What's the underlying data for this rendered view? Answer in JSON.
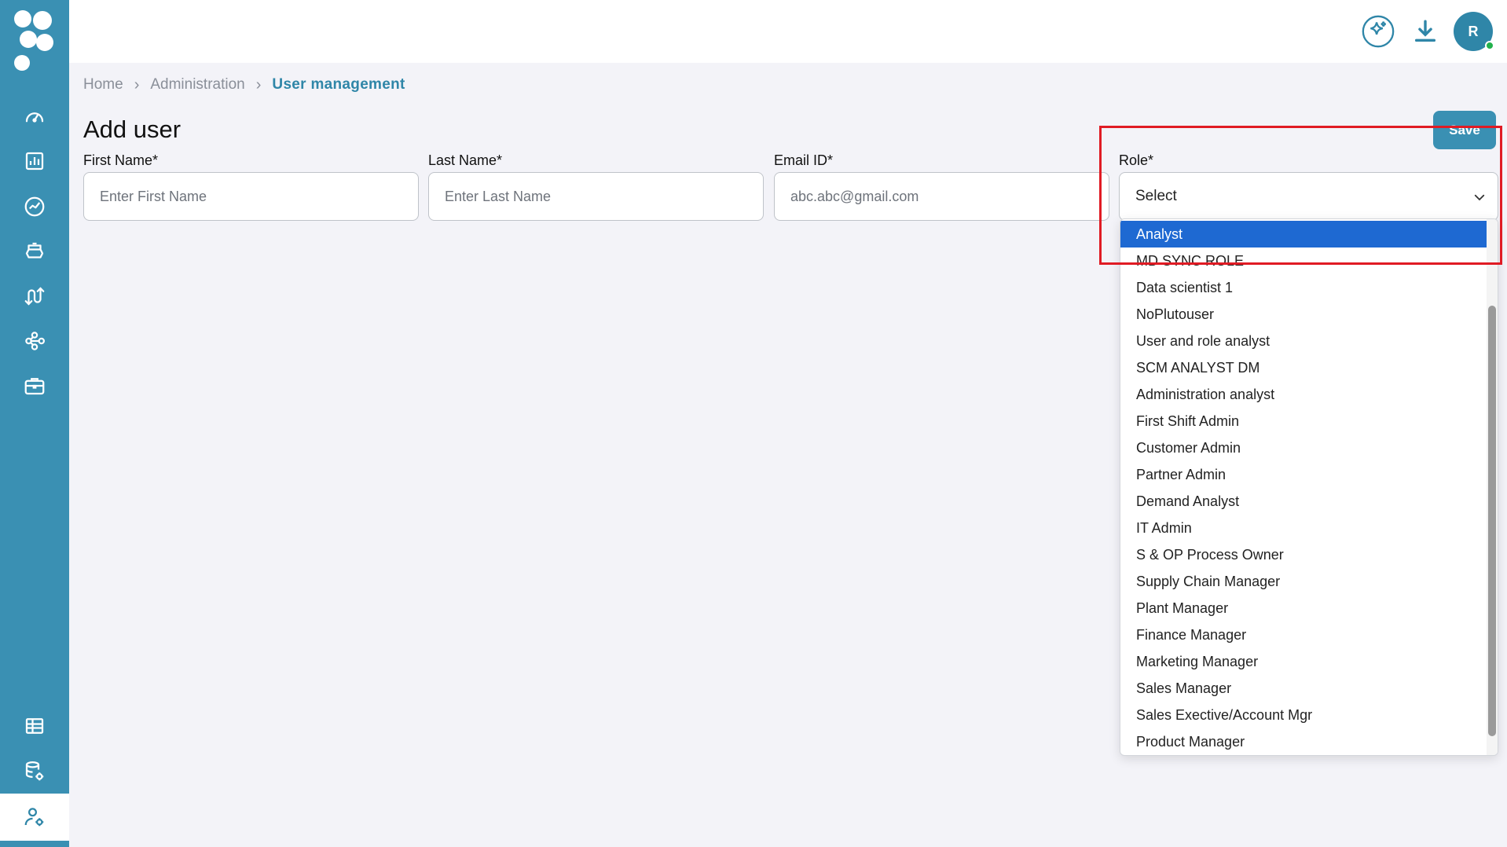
{
  "breadcrumb": {
    "home": "Home",
    "admin": "Administration",
    "current": "User management"
  },
  "page": {
    "title": "Add user",
    "save_label": "Save"
  },
  "form": {
    "first_name": {
      "label": "First Name*",
      "placeholder": "Enter First Name"
    },
    "last_name": {
      "label": "Last Name*",
      "placeholder": "Enter Last Name"
    },
    "email": {
      "label": "Email ID*",
      "placeholder": "abc.abc@gmail.com"
    },
    "role": {
      "label": "Role*",
      "value": "Select"
    }
  },
  "user": {
    "avatar_initial": "R"
  },
  "role_options": [
    "Analyst",
    "MD SYNC ROLE",
    "Data scientist 1",
    "NoPlutouser",
    "User and role analyst",
    "SCM ANALYST DM",
    "Administration analyst",
    "First Shift Admin",
    "Customer Admin",
    "Partner Admin",
    "Demand Analyst",
    "IT Admin",
    "S & OP Process Owner",
    "Supply Chain Manager",
    "Plant Manager",
    "Finance Manager",
    "Marketing Manager",
    "Sales Manager",
    "Sales Exective/Account Mgr",
    "Product Manager"
  ],
  "colors": {
    "sidebar": "#3a90b3",
    "accent": "#2f86a8",
    "selected_option": "#1e69d2",
    "highlight": "#e01b24"
  }
}
